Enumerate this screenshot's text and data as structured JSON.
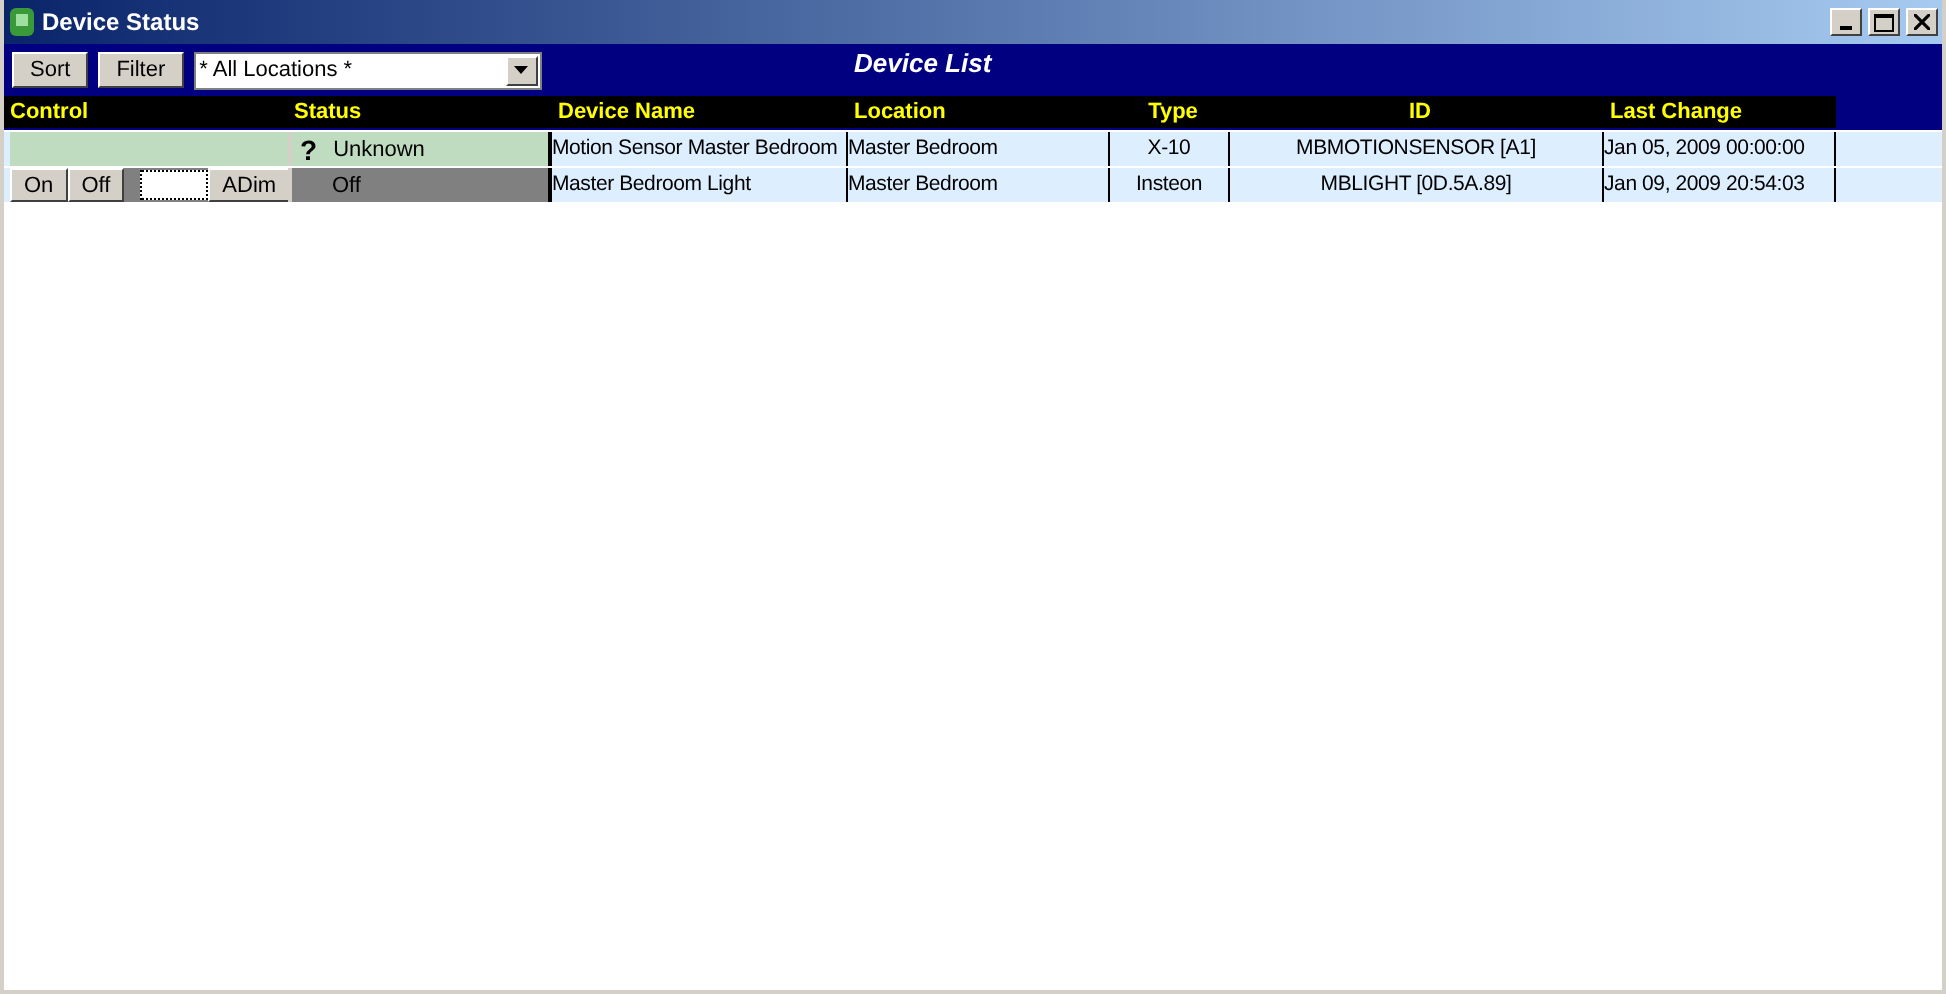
{
  "window": {
    "title": "Device Status"
  },
  "toolbar": {
    "buttons": [
      "Sort",
      "Filter"
    ],
    "location_select": "* All Locations *",
    "heading": "Device List"
  },
  "table": {
    "columns": [
      "Control",
      "Status",
      "Device Name",
      "Location",
      "Type",
      "ID",
      "Last Change"
    ],
    "rows": [
      {
        "kind": "sensor",
        "status_icon": "?",
        "status": "Unknown",
        "color": "#c0dcc0",
        "device_name": "Motion Sensor Master Bedroom",
        "location": "Master Bedroom",
        "type": "X-10",
        "id": "MBMOTIONSENSOR [A1]",
        "last_change": "Jan 05, 2009 00:00:00"
      },
      {
        "kind": "dimmer",
        "controls": [
          "On",
          "Off",
          "ADim"
        ],
        "status": "Off",
        "color": "#808080",
        "device_name": "Master Bedroom Light",
        "location": "Master Bedroom",
        "type": "Insteon",
        "id": "MBLIGHT [0D.5A.89]",
        "last_change": "Jan 09, 2009 20:54:03"
      }
    ]
  }
}
